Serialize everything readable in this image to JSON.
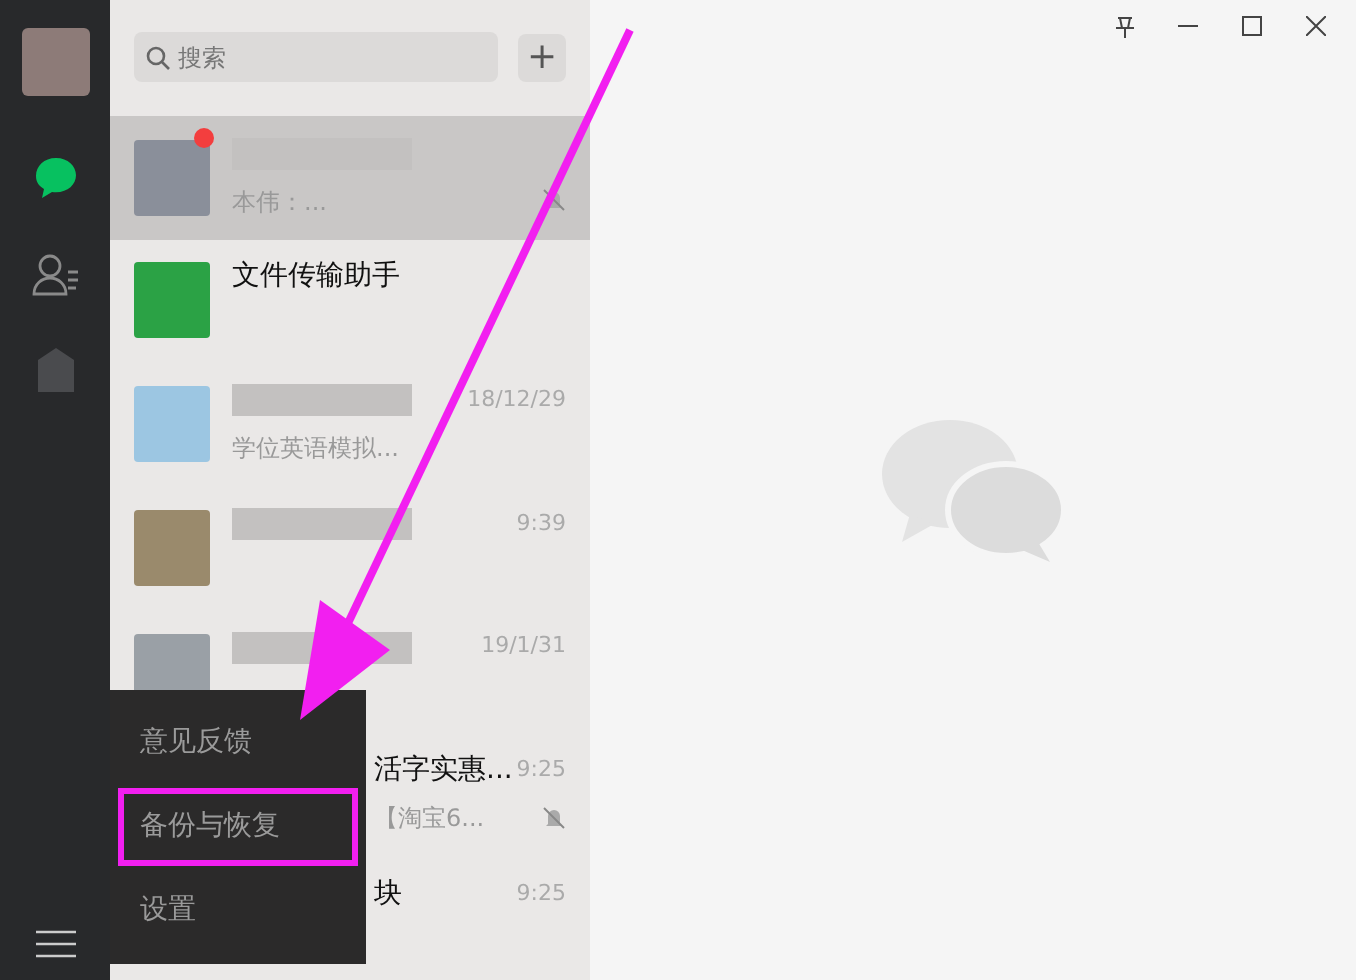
{
  "sidebar": {
    "items": [
      {
        "kind": "chat",
        "selected": true
      },
      {
        "kind": "contacts",
        "selected": false
      },
      {
        "kind": "favorites",
        "selected": false
      }
    ]
  },
  "search": {
    "placeholder": "搜索"
  },
  "add_button": "+",
  "chats": [
    {
      "message": "本伟：...",
      "muted": true,
      "unread": true,
      "selected": true
    },
    {
      "name": "文件传输助手",
      "muted": false,
      "unread": false,
      "selected": false
    },
    {
      "time": "18/12/29",
      "message": "学位英语模拟...",
      "muted": false,
      "unread": false,
      "selected": false
    },
    {
      "time": "9:39",
      "muted": false,
      "unread": false,
      "selected": false
    },
    {
      "time": "19/1/31",
      "muted": false,
      "unread": false,
      "selected": false
    },
    {
      "name": "活字实惠...",
      "time": "9:25",
      "message": "【淘宝6...",
      "muted": true,
      "unread": false,
      "selected": false
    },
    {
      "name": "块",
      "time": "9:25",
      "muted": false,
      "unread": false,
      "selected": false
    }
  ],
  "menu": [
    {
      "label": "意见反馈",
      "annotated": false
    },
    {
      "label": "备份与恢复",
      "annotated": true
    },
    {
      "label": "设置",
      "annotated": false
    }
  ]
}
